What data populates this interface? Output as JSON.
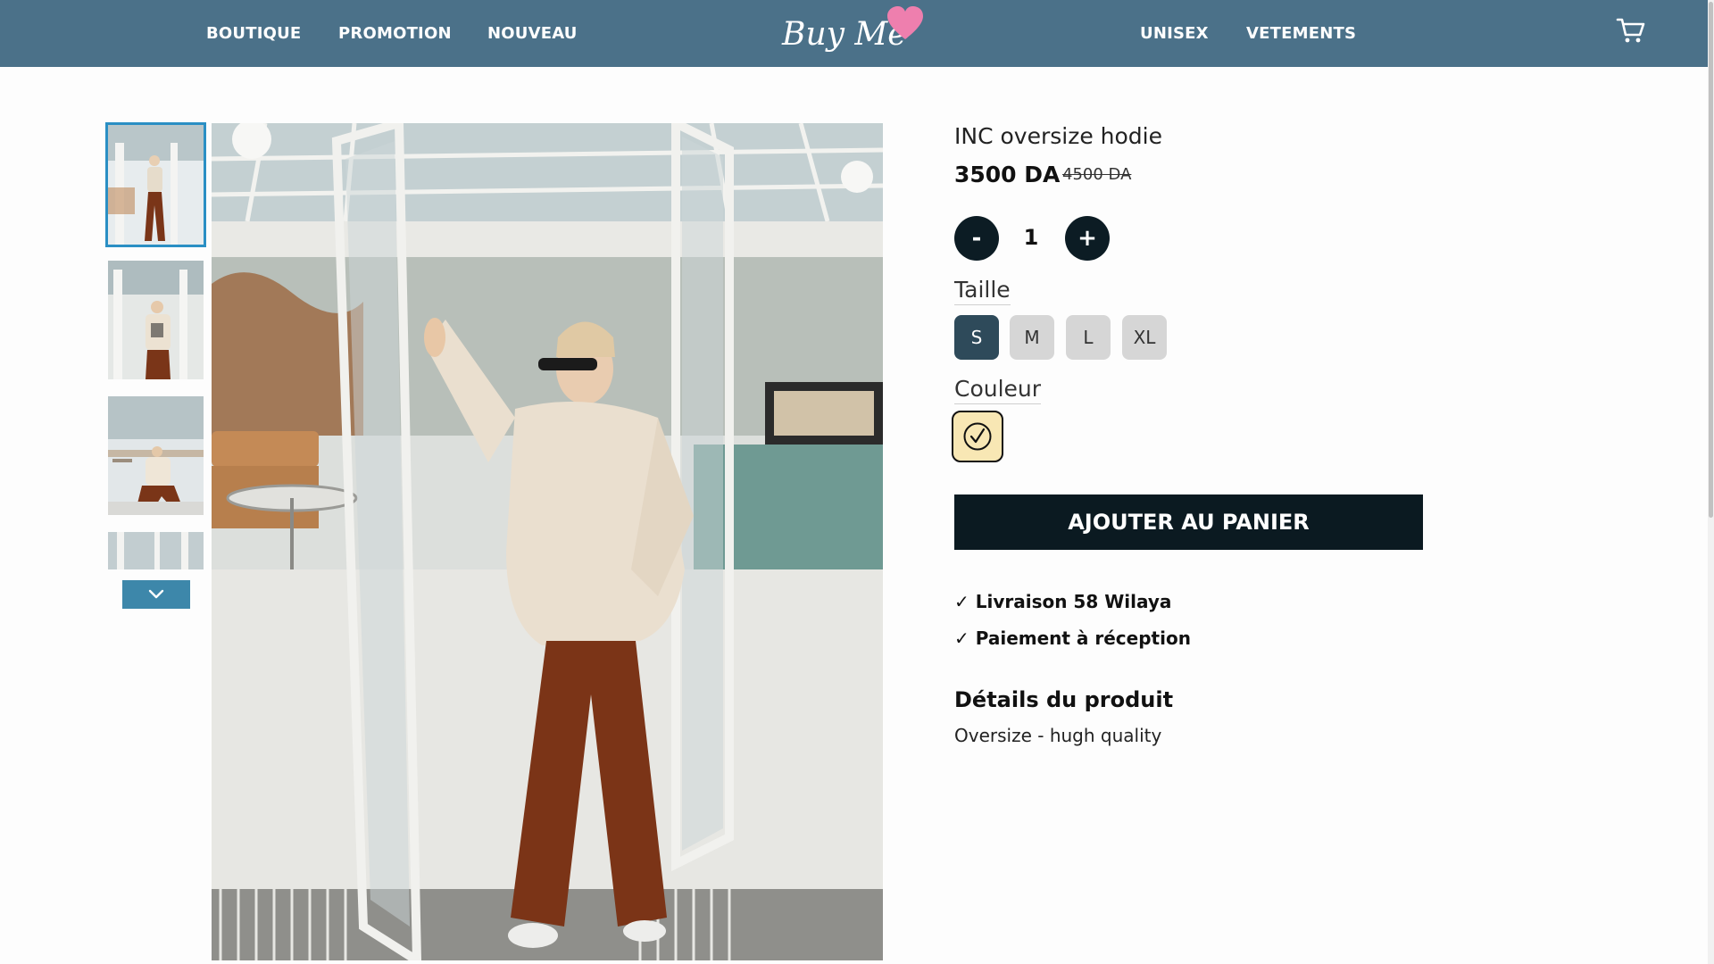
{
  "header": {
    "nav_left": [
      "BOUTIQUE",
      "PROMOTION",
      "NOUVEAU"
    ],
    "nav_right": [
      "UNISEX",
      "VETEMENTS"
    ],
    "logo_text": "Buy Me",
    "cart_icon": "shopping-cart-icon"
  },
  "gallery": {
    "thumbnail_count_visible": 4,
    "active_index": 0,
    "scroll_down_icon": "chevron-down-icon"
  },
  "product": {
    "title": "INC oversize hodie",
    "price": "3500 DA",
    "old_price": "4500 DA",
    "quantity": "1",
    "qty_minus": "-",
    "qty_plus": "+",
    "size_label": "Taille",
    "sizes": [
      "S",
      "M",
      "L",
      "XL"
    ],
    "selected_size": "S",
    "color_label": "Couleur",
    "colors": [
      {
        "hex": "#f8e7b4",
        "selected": true
      }
    ],
    "add_to_cart": "AJOUTER AU PANIER",
    "perks": [
      "✓ Livraison 58 Wilaya",
      "✓ Paiement à réception"
    ],
    "details_title": "Détails du produit",
    "details_text": "Oversize - hugh quality"
  },
  "colors": {
    "header_bg": "#4b7189",
    "accent_dark": "#0b1a21",
    "size_selected": "#2e4a5a",
    "thumb_active_border": "#2a8fc4"
  }
}
